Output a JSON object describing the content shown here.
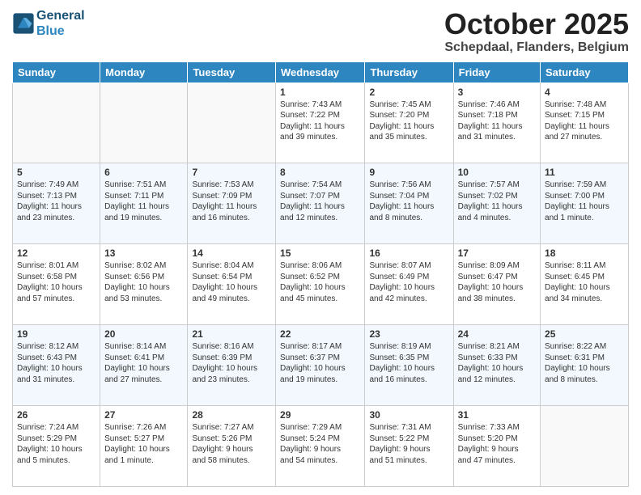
{
  "header": {
    "logo_line1": "General",
    "logo_line2": "Blue",
    "month": "October 2025",
    "location": "Schepdaal, Flanders, Belgium"
  },
  "weekdays": [
    "Sunday",
    "Monday",
    "Tuesday",
    "Wednesday",
    "Thursday",
    "Friday",
    "Saturday"
  ],
  "weeks": [
    [
      {
        "day": "",
        "info": ""
      },
      {
        "day": "",
        "info": ""
      },
      {
        "day": "",
        "info": ""
      },
      {
        "day": "1",
        "info": "Sunrise: 7:43 AM\nSunset: 7:22 PM\nDaylight: 11 hours\nand 39 minutes."
      },
      {
        "day": "2",
        "info": "Sunrise: 7:45 AM\nSunset: 7:20 PM\nDaylight: 11 hours\nand 35 minutes."
      },
      {
        "day": "3",
        "info": "Sunrise: 7:46 AM\nSunset: 7:18 PM\nDaylight: 11 hours\nand 31 minutes."
      },
      {
        "day": "4",
        "info": "Sunrise: 7:48 AM\nSunset: 7:15 PM\nDaylight: 11 hours\nand 27 minutes."
      }
    ],
    [
      {
        "day": "5",
        "info": "Sunrise: 7:49 AM\nSunset: 7:13 PM\nDaylight: 11 hours\nand 23 minutes."
      },
      {
        "day": "6",
        "info": "Sunrise: 7:51 AM\nSunset: 7:11 PM\nDaylight: 11 hours\nand 19 minutes."
      },
      {
        "day": "7",
        "info": "Sunrise: 7:53 AM\nSunset: 7:09 PM\nDaylight: 11 hours\nand 16 minutes."
      },
      {
        "day": "8",
        "info": "Sunrise: 7:54 AM\nSunset: 7:07 PM\nDaylight: 11 hours\nand 12 minutes."
      },
      {
        "day": "9",
        "info": "Sunrise: 7:56 AM\nSunset: 7:04 PM\nDaylight: 11 hours\nand 8 minutes."
      },
      {
        "day": "10",
        "info": "Sunrise: 7:57 AM\nSunset: 7:02 PM\nDaylight: 11 hours\nand 4 minutes."
      },
      {
        "day": "11",
        "info": "Sunrise: 7:59 AM\nSunset: 7:00 PM\nDaylight: 11 hours\nand 1 minute."
      }
    ],
    [
      {
        "day": "12",
        "info": "Sunrise: 8:01 AM\nSunset: 6:58 PM\nDaylight: 10 hours\nand 57 minutes."
      },
      {
        "day": "13",
        "info": "Sunrise: 8:02 AM\nSunset: 6:56 PM\nDaylight: 10 hours\nand 53 minutes."
      },
      {
        "day": "14",
        "info": "Sunrise: 8:04 AM\nSunset: 6:54 PM\nDaylight: 10 hours\nand 49 minutes."
      },
      {
        "day": "15",
        "info": "Sunrise: 8:06 AM\nSunset: 6:52 PM\nDaylight: 10 hours\nand 45 minutes."
      },
      {
        "day": "16",
        "info": "Sunrise: 8:07 AM\nSunset: 6:49 PM\nDaylight: 10 hours\nand 42 minutes."
      },
      {
        "day": "17",
        "info": "Sunrise: 8:09 AM\nSunset: 6:47 PM\nDaylight: 10 hours\nand 38 minutes."
      },
      {
        "day": "18",
        "info": "Sunrise: 8:11 AM\nSunset: 6:45 PM\nDaylight: 10 hours\nand 34 minutes."
      }
    ],
    [
      {
        "day": "19",
        "info": "Sunrise: 8:12 AM\nSunset: 6:43 PM\nDaylight: 10 hours\nand 31 minutes."
      },
      {
        "day": "20",
        "info": "Sunrise: 8:14 AM\nSunset: 6:41 PM\nDaylight: 10 hours\nand 27 minutes."
      },
      {
        "day": "21",
        "info": "Sunrise: 8:16 AM\nSunset: 6:39 PM\nDaylight: 10 hours\nand 23 minutes."
      },
      {
        "day": "22",
        "info": "Sunrise: 8:17 AM\nSunset: 6:37 PM\nDaylight: 10 hours\nand 19 minutes."
      },
      {
        "day": "23",
        "info": "Sunrise: 8:19 AM\nSunset: 6:35 PM\nDaylight: 10 hours\nand 16 minutes."
      },
      {
        "day": "24",
        "info": "Sunrise: 8:21 AM\nSunset: 6:33 PM\nDaylight: 10 hours\nand 12 minutes."
      },
      {
        "day": "25",
        "info": "Sunrise: 8:22 AM\nSunset: 6:31 PM\nDaylight: 10 hours\nand 8 minutes."
      }
    ],
    [
      {
        "day": "26",
        "info": "Sunrise: 7:24 AM\nSunset: 5:29 PM\nDaylight: 10 hours\nand 5 minutes."
      },
      {
        "day": "27",
        "info": "Sunrise: 7:26 AM\nSunset: 5:27 PM\nDaylight: 10 hours\nand 1 minute."
      },
      {
        "day": "28",
        "info": "Sunrise: 7:27 AM\nSunset: 5:26 PM\nDaylight: 9 hours\nand 58 minutes."
      },
      {
        "day": "29",
        "info": "Sunrise: 7:29 AM\nSunset: 5:24 PM\nDaylight: 9 hours\nand 54 minutes."
      },
      {
        "day": "30",
        "info": "Sunrise: 7:31 AM\nSunset: 5:22 PM\nDaylight: 9 hours\nand 51 minutes."
      },
      {
        "day": "31",
        "info": "Sunrise: 7:33 AM\nSunset: 5:20 PM\nDaylight: 9 hours\nand 47 minutes."
      },
      {
        "day": "",
        "info": ""
      }
    ]
  ]
}
